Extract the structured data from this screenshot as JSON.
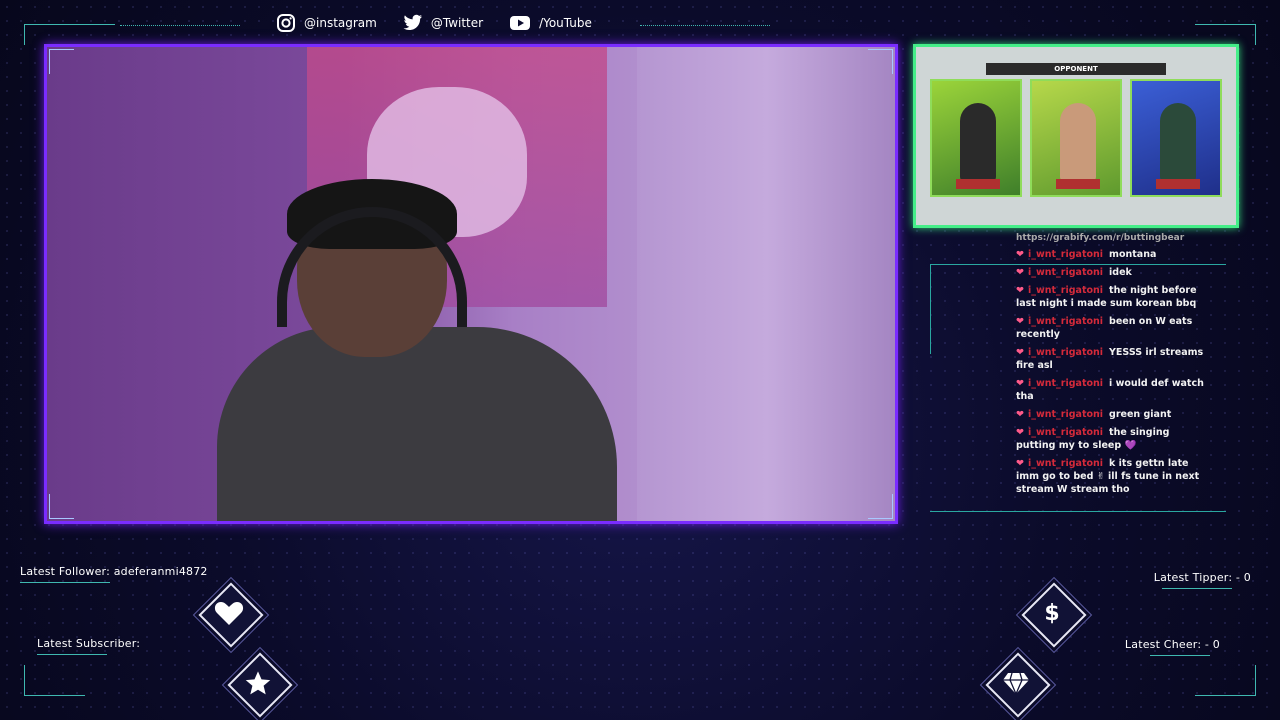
{
  "social": {
    "instagram": "@instagram",
    "twitter": "@Twitter",
    "youtube": "/YouTube"
  },
  "game": {
    "banner": "OPPONENT",
    "url_fragment": "https://grabify.com/r/buttingbear"
  },
  "chat": {
    "messages": [
      {
        "user": "i_wnt_rigatoni",
        "text": "montana"
      },
      {
        "user": "i_wnt_rigatoni",
        "text": "idek"
      },
      {
        "user": "i_wnt_rigatoni",
        "text": "the night before last night i made sum korean bbq"
      },
      {
        "user": "i_wnt_rigatoni",
        "text": "been on W eats recently"
      },
      {
        "user": "i_wnt_rigatoni",
        "text": "YESSS irl streams fire asl"
      },
      {
        "user": "i_wnt_rigatoni",
        "text": "i would def watch tha"
      },
      {
        "user": "i_wnt_rigatoni",
        "text": "green giant"
      },
      {
        "user": "i_wnt_rigatoni",
        "text": "the singing putting my to sleep 💜"
      },
      {
        "user": "i_wnt_rigatoni",
        "text": "k its gettn late imm go to bed ✌ ill fs tune in next stream W stream tho"
      }
    ]
  },
  "alerts": {
    "latest_follower": "Latest Follower: adeferanmi4872",
    "latest_subscriber": "Latest Subscriber:",
    "latest_tipper": "Latest Tipper: - 0",
    "latest_cheer": "Latest Cheer: - 0"
  },
  "icons": {
    "follower": "heart-icon",
    "subscriber": "star-icon",
    "tipper": "dollar-icon",
    "cheer": "gem-icon"
  },
  "colors": {
    "cam_border": "#7a2cff",
    "game_border": "#44ee88",
    "accent_teal": "#3fb8b0",
    "chat_user": "#d42a3a"
  }
}
